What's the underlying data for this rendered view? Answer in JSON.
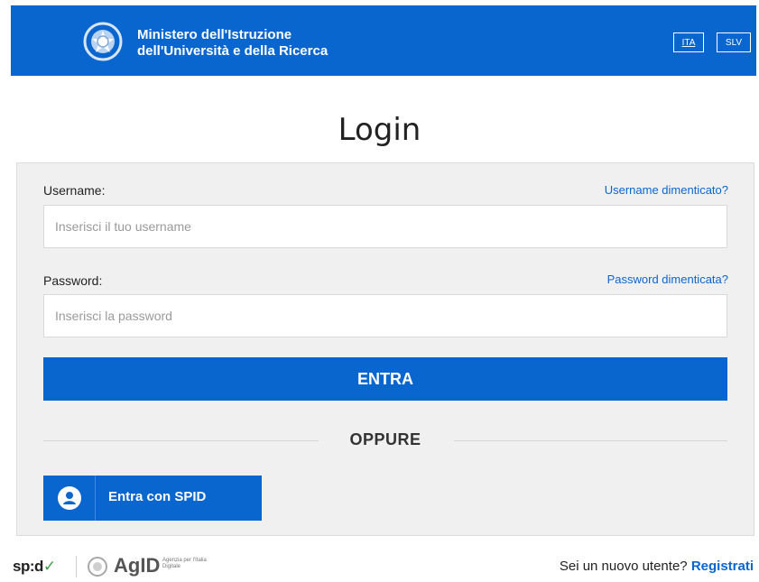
{
  "header": {
    "ministry_line1": "Ministero dell'Istruzione",
    "ministry_line2": "dell'Università e della Ricerca",
    "lang_ita": "ITA",
    "lang_slv": "SLV",
    "brand_color": "#0a66cf"
  },
  "page": {
    "title": "Login"
  },
  "form": {
    "username_label": "Username:",
    "username_forgot": "Username dimenticato?",
    "username_placeholder": "Inserisci il tuo username",
    "username_value": "",
    "password_label": "Password:",
    "password_forgot": "Password dimenticata?",
    "password_placeholder": "Inserisci la password",
    "password_value": "",
    "submit_label": "ENTRA",
    "separator": "OPPURE",
    "spid_label": "Entra con SPID"
  },
  "footer": {
    "spid_logo": "sp:d",
    "agid_logo": "AgID",
    "agid_sub": "Agenzia per l'Italia Digitale",
    "new_user_text": "Sei un nuovo utente?",
    "register_link": "Registrati"
  },
  "icons": {
    "emblem": "italian-republic-emblem-icon",
    "spid_user": "user-icon",
    "spid_check": "check-icon",
    "agid": "agid-logo-icon"
  }
}
